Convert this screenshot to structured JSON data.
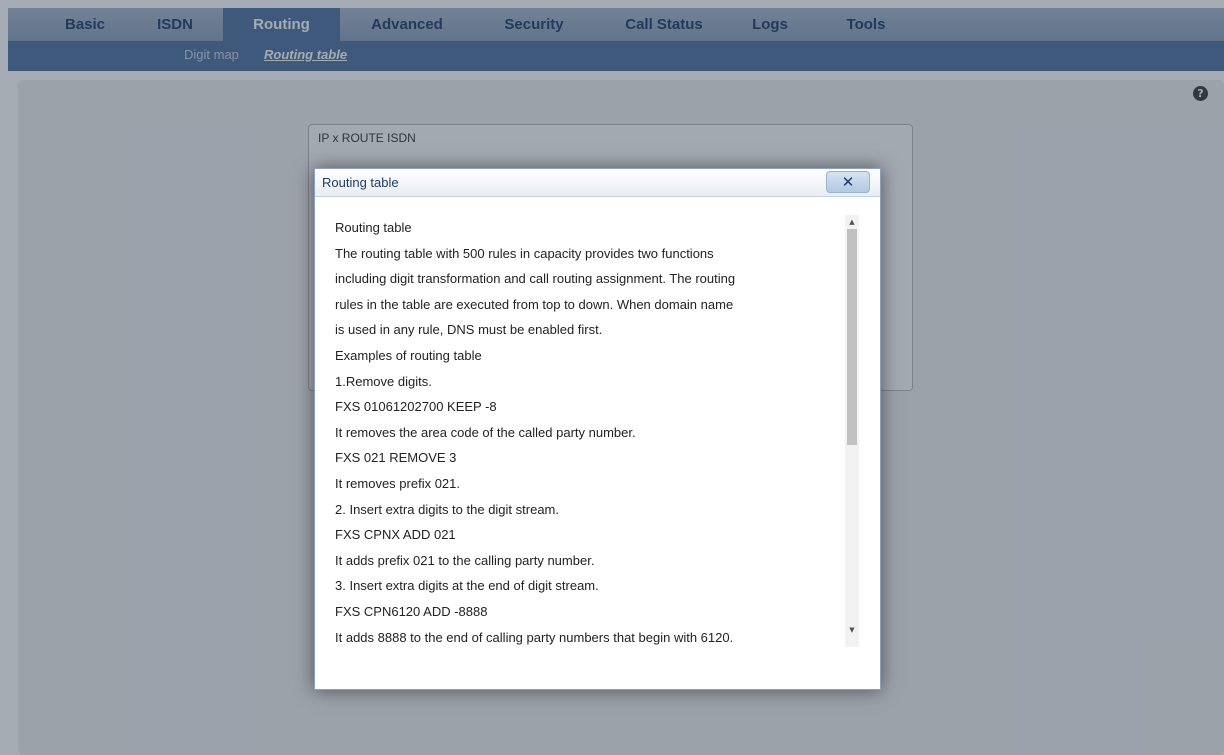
{
  "nav": {
    "tabs": [
      {
        "label": "Basic"
      },
      {
        "label": "ISDN"
      },
      {
        "label": "Routing"
      },
      {
        "label": "Advanced"
      },
      {
        "label": "Security"
      },
      {
        "label": "Call Status"
      },
      {
        "label": "Logs"
      },
      {
        "label": "Tools"
      }
    ],
    "active_tab": "Routing"
  },
  "subnav": {
    "items": [
      {
        "label": "Digit map"
      },
      {
        "label": "Routing table"
      }
    ],
    "active_item": "Routing table"
  },
  "help": {
    "glyph": "?"
  },
  "rules_box": {
    "text": "IP   x ROUTE ISDN"
  },
  "dialog": {
    "title": "Routing table",
    "close_glyph": "✕",
    "lines": [
      "Routing table",
      "The routing table with 500 rules in capacity provides two functions",
      "including digit transformation and call routing assignment. The routing",
      "rules in the table are executed from top to down. When domain name",
      "is used in any rule, DNS must be enabled first.",
      "Examples of routing table",
      "1.Remove digits.",
      "FXS 01061202700 KEEP -8",
      "It removes the area code of the called party number.",
      "FXS 021 REMOVE 3",
      "It removes prefix 021.",
      "2. Insert extra digits to the digit stream.",
      "FXS CPNX ADD 021",
      "It adds prefix 021 to the calling party number.",
      "3. Insert extra digits at the end of digit stream.",
      "FXS CPN6120 ADD -8888",
      "It adds 8888 to the end of calling party numbers that begin with 6120."
    ],
    "scroll_up_glyph": "▲",
    "scroll_down_glyph": "▼"
  }
}
